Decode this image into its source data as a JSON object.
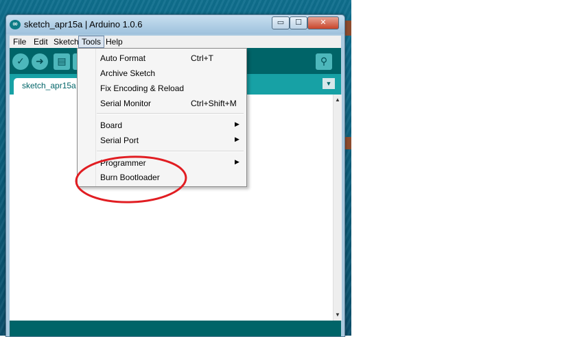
{
  "window": {
    "title": "sketch_apr15a | Arduino 1.0.6",
    "app_icon": "arduino-logo-icon"
  },
  "title_buttons": {
    "minimize": "▭",
    "maximize": "☐",
    "close": "✕"
  },
  "menubar": {
    "items": [
      "File",
      "Edit",
      "Sketch",
      "Tools",
      "Help"
    ],
    "active": "Tools"
  },
  "toolbar": {
    "verify_icon": "check-icon",
    "upload_icon": "arrow-right-icon",
    "new_icon": "new-file-icon",
    "open_icon": "open-icon",
    "serial_icon": "magnifier-icon"
  },
  "tab": {
    "label": "sketch_apr15a",
    "menu_icon": "triangle-down-icon"
  },
  "tools_menu": {
    "items": [
      {
        "label": "Auto Format",
        "shortcut": "Ctrl+T"
      },
      {
        "label": "Archive Sketch",
        "shortcut": ""
      },
      {
        "label": "Fix Encoding & Reload",
        "shortcut": ""
      },
      {
        "label": "Serial Monitor",
        "shortcut": "Ctrl+Shift+M"
      },
      {
        "label": "Board",
        "submenu": true
      },
      {
        "label": "Serial Port",
        "submenu": true
      },
      {
        "label": "Programmer",
        "submenu": true
      },
      {
        "label": "Burn Bootloader",
        "shortcut": ""
      }
    ],
    "submenu_arrow": "▶"
  },
  "annotation": {
    "shape": "ellipse",
    "color": "#e11d22",
    "encloses": [
      "Programmer",
      "Burn Bootloader"
    ]
  },
  "colors": {
    "toolbar": "#006468",
    "tabbar": "#17a1a5",
    "accent": "#4db7bb"
  }
}
